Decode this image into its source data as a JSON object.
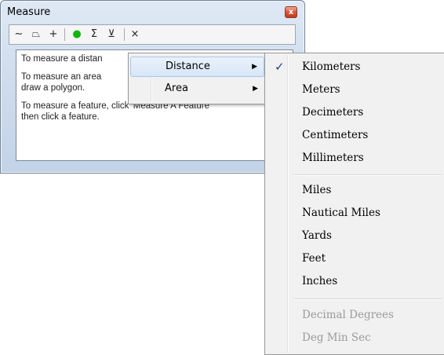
{
  "window": {
    "title": "Measure",
    "close_glyph": "x",
    "toolbar": [
      {
        "icon": "measure-line-icon",
        "glyph": "∼"
      },
      {
        "icon": "measure-area-icon",
        "glyph": "⏢"
      },
      {
        "icon": "measure-point-icon",
        "glyph": "+"
      },
      {
        "icon": "measure-feature-icon",
        "glyph": "●"
      },
      {
        "icon": "sum-icon",
        "glyph": "Σ"
      },
      {
        "icon": "units-dropdown-icon",
        "glyph": "⊻"
      },
      {
        "icon": "clear-icon",
        "glyph": "×"
      }
    ],
    "content": {
      "line1": "To measure a distan",
      "line2": "To measure an area",
      "line3": "draw a polygon.",
      "line4": "To measure a feature, click 'Measure A Feature",
      "line5": "then click a feature."
    }
  },
  "menu": {
    "items": [
      {
        "label": "Distance",
        "arrow": "▶"
      },
      {
        "label": "Area",
        "arrow": "▶"
      }
    ]
  },
  "submenu": {
    "checkmark": "✓",
    "group1": [
      "Kilometers",
      "Meters",
      "Decimeters",
      "Centimeters",
      "Millimeters"
    ],
    "group2": [
      "Miles",
      "Nautical Miles",
      "Yards",
      "Feet",
      "Inches"
    ],
    "group3": [
      "Decimal Degrees",
      "Deg Min Sec"
    ],
    "selected": "Kilometers"
  },
  "colors": {
    "accent_check": "#1f3f8a",
    "close_button": "#d9583a"
  }
}
